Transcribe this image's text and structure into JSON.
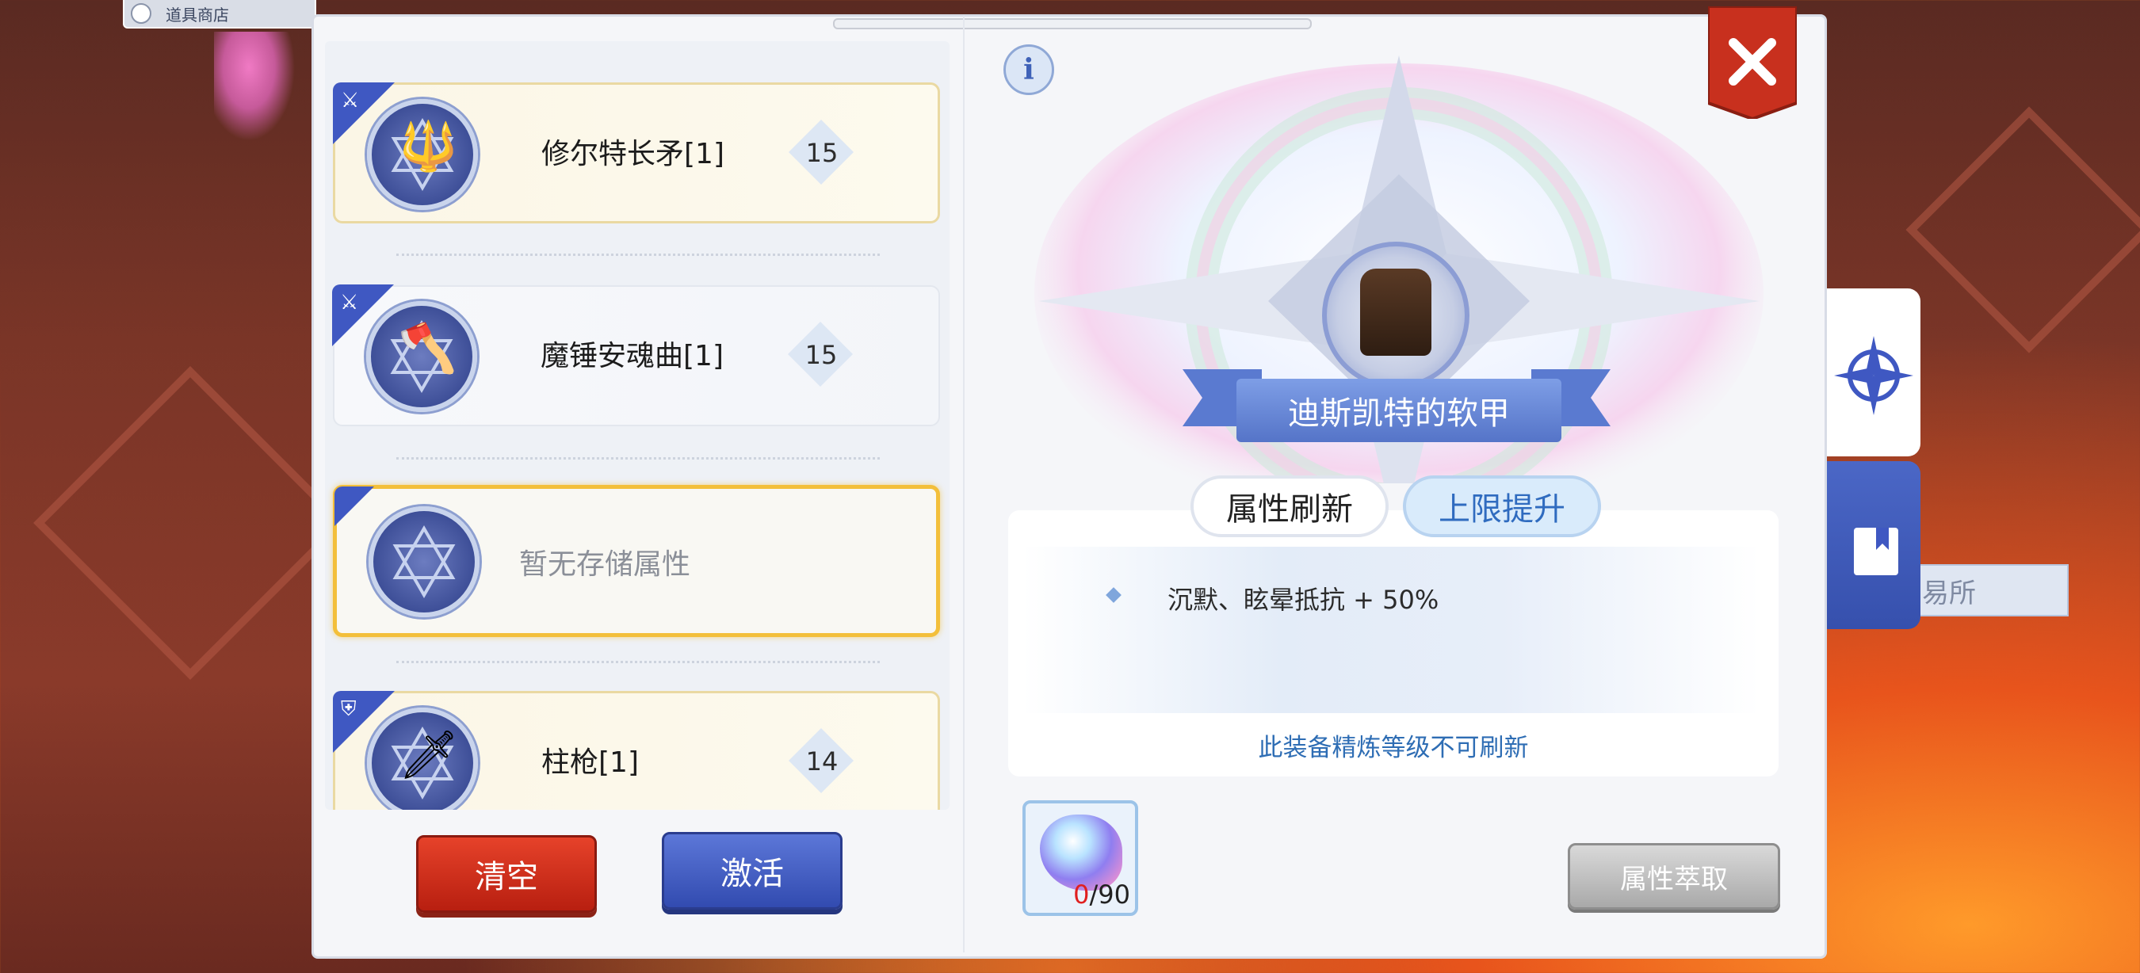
{
  "top_left": {
    "shop_label": "道具商店"
  },
  "side_label": "易所",
  "list": {
    "items": [
      {
        "name": "修尔特长矛[1]",
        "value": "15",
        "style": "gold",
        "category_icon": "sword-icon",
        "weapon_icon": "spear-icon"
      },
      {
        "name": "魔锤安魂曲[1]",
        "value": "15",
        "style": "plain",
        "category_icon": "sword-icon",
        "weapon_icon": "axe-icon"
      },
      {
        "name": "暂无存储属性",
        "value": "",
        "style": "selected",
        "category_icon": "",
        "weapon_icon": ""
      },
      {
        "name": "柱枪[1]",
        "value": "14",
        "style": "gold",
        "category_icon": "shield-icon",
        "weapon_icon": "sword-icon"
      }
    ]
  },
  "buttons": {
    "clear": "清空",
    "activate": "激活"
  },
  "detail": {
    "item_name": "迪斯凯特的软甲",
    "tabs": [
      "属性刷新",
      "上限提升"
    ],
    "active_tab": "上限提升",
    "attribute": "沉默、眩晕抵抗 + 50%",
    "note": "此装备精炼等级不可刷新",
    "material": {
      "have": "0",
      "sep": "/",
      "need": "90"
    },
    "extract_label": "属性萃取"
  },
  "colors": {
    "accent_blue": "#3f58c2",
    "accent_gold": "#f3bf3a",
    "clear_red": "#d1301c",
    "info_text": "#2e6db4"
  }
}
